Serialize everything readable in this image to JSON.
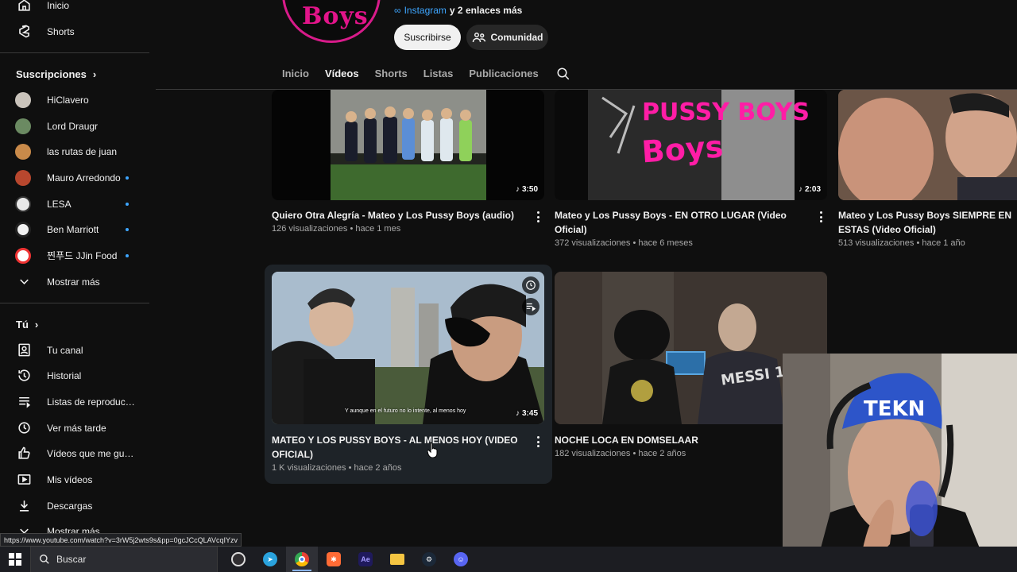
{
  "sidebar": {
    "top_items": [
      {
        "label": "Inicio",
        "icon": "home-icon"
      },
      {
        "label": "Shorts",
        "icon": "shorts-icon"
      }
    ],
    "subscriptions_title": "Suscripciones",
    "subscriptions": [
      {
        "label": "HiClavero",
        "color": "#c9c3bb",
        "live": false
      },
      {
        "label": "Lord Draugr",
        "color": "#6b8a62",
        "live": false
      },
      {
        "label": "las rutas de juan",
        "color": "#c98a4a",
        "live": false
      },
      {
        "label": "Mauro Arredondo",
        "color": "#b8472e",
        "live": true
      },
      {
        "label": "LESA",
        "color": "#e8e8e8",
        "live": true
      },
      {
        "label": "Ben Marriott",
        "color": "#f2f2f2",
        "live": true
      },
      {
        "label": "찐푸드 JJin Food",
        "color": "#ffffff",
        "live": true
      }
    ],
    "show_more": "Mostrar más",
    "you_title": "Tú",
    "you_items": [
      {
        "label": "Tu canal",
        "icon": "user-box-icon"
      },
      {
        "label": "Historial",
        "icon": "history-icon"
      },
      {
        "label": "Listas de reproducc...",
        "icon": "playlist-icon"
      },
      {
        "label": "Ver más tarde",
        "icon": "clock-icon"
      },
      {
        "label": "Vídeos que me gus...",
        "icon": "thumbs-up-icon"
      },
      {
        "label": "Mis vídeos",
        "icon": "video-icon"
      },
      {
        "label": "Descargas",
        "icon": "download-icon"
      }
    ],
    "show_more_2": "Mostrar más"
  },
  "channel": {
    "logo_text": "Boys",
    "links_instagram": "Instagram",
    "links_more": "y 2 enlaces más",
    "subscribe": "Suscribirse",
    "community": "Comunidad"
  },
  "tabs": [
    "Inicio",
    "Vídeos",
    "Shorts",
    "Listas",
    "Publicaciones"
  ],
  "active_tab": "Vídeos",
  "videos": [
    {
      "title": "Quiero Otra Alegría - Mateo y Los Pussy Boys (audio)",
      "meta": "126 visualizaciones • hace 1 mes",
      "duration": "3:50"
    },
    {
      "title": "Mateo y Los Pussy Boys - EN OTRO LUGAR (Video Oficial)",
      "meta": "372 visualizaciones • hace 6 meses",
      "duration": "2:03"
    },
    {
      "title": "Mateo y Los Pussy Boys  SIEMPRE EN ESTAS (Video Oficial)",
      "meta": "513 visualizaciones • hace 1 año",
      "duration": ""
    },
    {
      "title": "MATEO Y LOS PUSSY BOYS - AL MENOS HOY (VIDEO OFICIAL)",
      "meta": "1 K visualizaciones • hace 2 años",
      "duration": "3:45",
      "subtitle": "Y aunque en el futuro no lo intente, al menos hoy"
    },
    {
      "title": "NOCHE LOCA EN DOMSELAAR",
      "meta": "182 visualizaciones • hace 2 años",
      "duration": "",
      "shirt_text": "MESSI 10"
    }
  ],
  "thumb2_text": "PUSSY BOYS",
  "webcam_cap_text": "TEKN",
  "status_url": "https://www.youtube.com/watch?v=3rW5j2wts9s&pp=0gcJCcQLAVcqIYzv",
  "taskbar": {
    "search_placeholder": "Buscar",
    "apps": [
      {
        "name": "obs-icon",
        "color": "#302e31",
        "active": false
      },
      {
        "name": "telegram-icon",
        "color": "#2aa3de",
        "active": false
      },
      {
        "name": "chrome-icon",
        "color": "#e84335",
        "active": true
      },
      {
        "name": "app-orange-icon",
        "color": "#ff6b35",
        "active": false
      },
      {
        "name": "after-effects-icon",
        "color": "#1f1a5c",
        "label": "Ae",
        "active": false
      },
      {
        "name": "file-explorer-icon",
        "color": "#f5c542",
        "active": false
      },
      {
        "name": "steam-icon",
        "color": "#1b2838",
        "active": false
      },
      {
        "name": "discord-icon",
        "color": "#5865f2",
        "active": false
      }
    ]
  }
}
